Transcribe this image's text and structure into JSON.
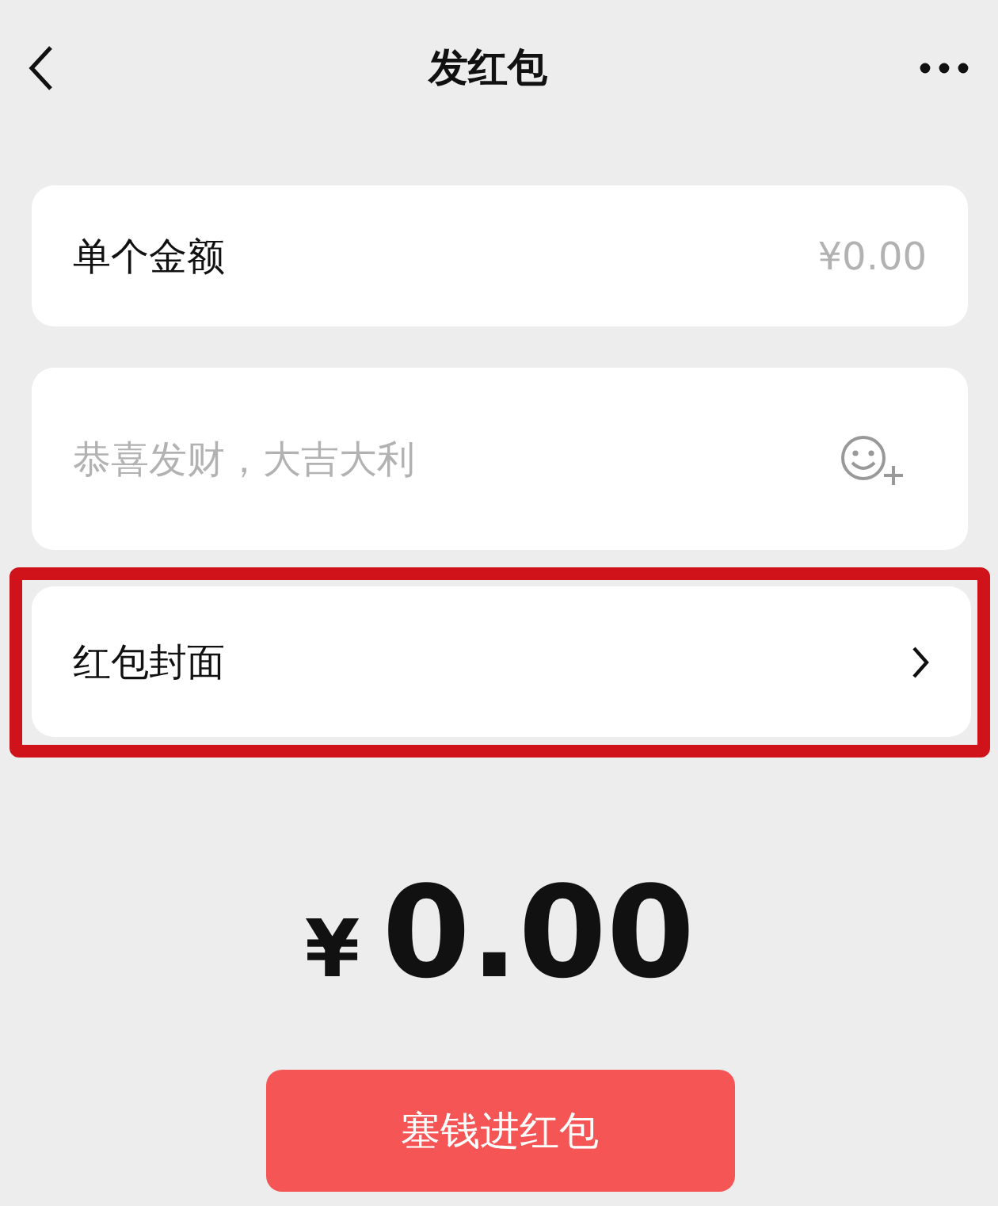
{
  "header": {
    "title": "发红包"
  },
  "fields": [
    {
      "kind": "amount",
      "label": "单个金额",
      "placeholder": "¥0.00"
    },
    {
      "kind": "greeting",
      "placeholder": "恭喜发财，大吉大利"
    }
  ],
  "cover_row": {
    "label": "红包封面",
    "highlighted": true
  },
  "total": {
    "currency": "¥",
    "amount": "0.00"
  },
  "submit_button": {
    "label": "塞钱进红包"
  }
}
